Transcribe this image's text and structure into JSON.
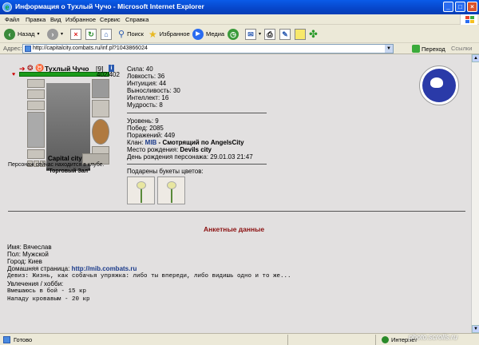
{
  "window": {
    "title": "Информация о Тухлый Чучо - Microsoft Internet Explorer",
    "minimize": "_",
    "maximize": "□",
    "close": "×"
  },
  "menu": [
    "Файл",
    "Правка",
    "Вид",
    "Избранное",
    "Сервис",
    "Справка"
  ],
  "toolbar": {
    "back": "Назад",
    "search": "Поиск",
    "favorites": "Избранное",
    "media": "Медиа"
  },
  "address": {
    "label": "Адрес:",
    "url": "http://capitalcity.combats.ru/inf.pl?1043866024",
    "go": "Переход",
    "links": "Ссылки"
  },
  "character": {
    "name": "Тухлый Чучо",
    "level": "[9]",
    "info_badge": "i",
    "hp": "402/402",
    "hp_fraction": 1.0,
    "location": "Capital city",
    "location_note": "Персонаж сейчас находится в клубе.",
    "room": "\"Торговый Зал\""
  },
  "stats": [
    "Сила: 40",
    "Ловкость: 36",
    "Интуиция: 44",
    "Выносливость: 30",
    "Интеллект: 16",
    "Мудрость: 8"
  ],
  "record": {
    "level": "Уровень: 9",
    "wins": "Побед: 2085",
    "losses": "Поражений: 449",
    "clan_label": "Клан:",
    "clan_name": "MIB",
    "clan_rest": " - Смотрящий по AngelsCity",
    "birthplace_label": "Место рождения:",
    "birthplace": "Devils city",
    "birthday": "День рождения персонажа: 29.01.03 21:47",
    "flowers_label": "Подарены букеты цветов:"
  },
  "profile": {
    "heading": "Анкетные данные",
    "name": "Имя: Вячеслав",
    "sex": "Пол: Мужской",
    "city": "Город: Киев",
    "homepage_label": "Домашняя страница:",
    "homepage": "http://mib.combats.ru",
    "motto": "Девиз: Жизнь, как собачья упряжка: либо ты впереди, либо видишь одно и то же...",
    "hobby_label": "Увлечения / хобби:",
    "hobby_1": "Вмешаюсь в бой - 15 кр",
    "hobby_2": "Нападу кровавым - 20 кр"
  },
  "status": {
    "left": "Готово",
    "zone": "Интернет"
  },
  "watermark": "photo.scrolls.ru",
  "colors": {
    "accent_red": "#8b1010",
    "link_blue": "#1a3a8a",
    "hp_green": "#1a9a1a",
    "page_bg": "#e2e0e0"
  }
}
